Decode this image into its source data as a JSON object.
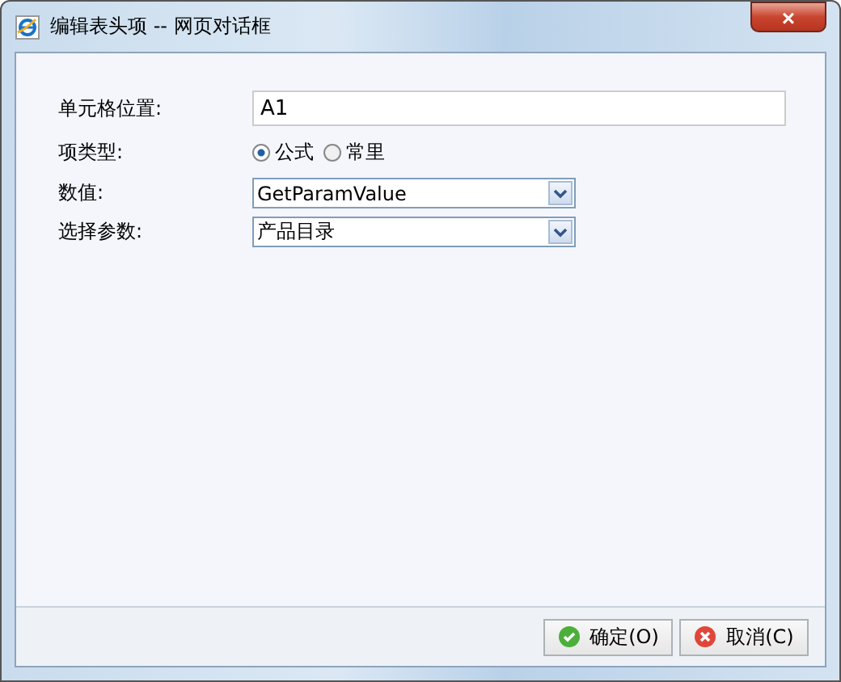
{
  "window": {
    "title": "编辑表头项 -- 网页对话框",
    "close": "×"
  },
  "form": {
    "cell_position": {
      "label": "单元格位置:",
      "value": "A1"
    },
    "item_type": {
      "label": "项类型:",
      "options": [
        {
          "label": "公式",
          "selected": true
        },
        {
          "label": "常里",
          "selected": false
        }
      ]
    },
    "value": {
      "label": "数值:",
      "value": "GetParamValue"
    },
    "parameter": {
      "label": "选择参数:",
      "value": "产品目录"
    }
  },
  "buttons": [
    {
      "label": "确定(O)",
      "kind": "ok"
    },
    {
      "label": "取消(C)",
      "kind": "cancel"
    }
  ]
}
